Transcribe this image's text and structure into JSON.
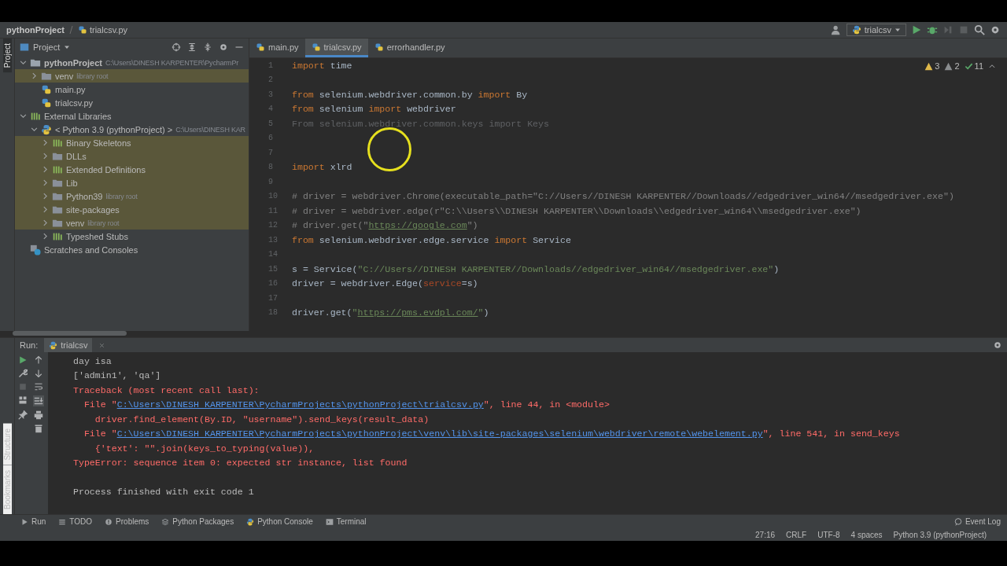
{
  "breadcrumb": {
    "project": "pythonProject",
    "file": "trialcsv.py"
  },
  "run_config": "trialcsv",
  "left_stripe_top": [
    {
      "label": "Project",
      "selected": true
    }
  ],
  "left_stripe_bottom": [
    {
      "label": "Structure",
      "selected": false
    },
    {
      "label": "Bookmarks",
      "selected": false
    }
  ],
  "project_panel": {
    "title": "Project",
    "tree": [
      {
        "name": "pythonProject",
        "hint": "C:\\Users\\DINESH KARPENTER\\PycharmPr",
        "kind": "project",
        "expanded": true,
        "highlighted": false,
        "children": [
          {
            "name": "venv",
            "hint": "library root",
            "kind": "folder",
            "expanded": false,
            "highlighted": true
          },
          {
            "name": "main.py",
            "kind": "pyfile",
            "highlighted": false
          },
          {
            "name": "trialcsv.py",
            "kind": "pyfile",
            "highlighted": false
          }
        ]
      },
      {
        "name": "External Libraries",
        "kind": "library",
        "expanded": true,
        "highlighted": false,
        "children": [
          {
            "name": "< Python 3.9 (pythonProject) >",
            "hint": "C:\\Users\\DINESH KAR",
            "kind": "python",
            "expanded": true,
            "highlighted": false,
            "children": [
              {
                "name": "Binary Skeletons",
                "kind": "library",
                "expanded": false,
                "highlighted": true
              },
              {
                "name": "DLLs",
                "kind": "folder",
                "expanded": false,
                "highlighted": true
              },
              {
                "name": "Extended Definitions",
                "kind": "library",
                "expanded": false,
                "highlighted": true
              },
              {
                "name": "Lib",
                "kind": "folder",
                "expanded": false,
                "highlighted": true
              },
              {
                "name": "Python39",
                "hint": "library root",
                "kind": "folder",
                "expanded": false,
                "highlighted": true
              },
              {
                "name": "site-packages",
                "kind": "folder",
                "expanded": false,
                "highlighted": true
              },
              {
                "name": "venv",
                "hint": "library root",
                "kind": "folder",
                "expanded": false,
                "highlighted": true
              },
              {
                "name": "Typeshed Stubs",
                "kind": "library",
                "expanded": false,
                "highlighted": false
              }
            ]
          }
        ]
      },
      {
        "name": "Scratches and Consoles",
        "kind": "scratches",
        "highlighted": false
      }
    ]
  },
  "editor_tabs": [
    {
      "label": "main.py",
      "selected": false
    },
    {
      "label": "trialcsv.py",
      "selected": true
    },
    {
      "label": "errorhandler.py",
      "selected": false
    }
  ],
  "inspections": {
    "warnings": "3",
    "weak_warnings": "2",
    "typos": "11"
  },
  "code": [
    {
      "number": "1",
      "tokens": [
        {
          "kind": "keyword",
          "text": "import"
        },
        {
          "kind": "plain",
          "text": " time"
        }
      ]
    },
    {
      "number": "2"
    },
    {
      "number": "3",
      "tokens": [
        {
          "kind": "keyword",
          "text": "from"
        },
        {
          "kind": "plain",
          "text": " selenium.webdriver.common.by "
        },
        {
          "kind": "keyword",
          "text": "import"
        },
        {
          "kind": "plain",
          "text": " By"
        }
      ]
    },
    {
      "number": "4",
      "tokens": [
        {
          "kind": "keyword",
          "text": "from"
        },
        {
          "kind": "plain",
          "text": " selenium "
        },
        {
          "kind": "keyword",
          "text": "import"
        },
        {
          "kind": "plain",
          "text": " webdriver"
        }
      ]
    },
    {
      "number": "5",
      "tokens": [
        {
          "kind": "unused",
          "text": "From selenium.webdriver.common.keys import Keys"
        }
      ]
    },
    {
      "number": "6"
    },
    {
      "number": "7"
    },
    {
      "number": "8",
      "tokens": [
        {
          "kind": "keyword",
          "text": "import"
        },
        {
          "kind": "plain",
          "text": " xlrd"
        }
      ]
    },
    {
      "number": "9"
    },
    {
      "number": "10",
      "tokens": [
        {
          "kind": "comment",
          "text": "# driver = webdriver.Chrome(executable_path=\"C://Users//DINESH KARPENTER//Downloads//edgedriver_win64//msedgedriver.exe\")"
        }
      ]
    },
    {
      "number": "11",
      "tokens": [
        {
          "kind": "comment",
          "text": "# driver = webdriver.edge(r\"C:\\\\Users\\\\DINESH KARPENTER\\\\Downloads\\\\edgedriver_win64\\\\msedgedriver.exe\")"
        }
      ]
    },
    {
      "number": "12",
      "tokens": [
        {
          "kind": "comment",
          "text": "# driver.get(\""
        },
        {
          "kind": "url",
          "text": "https://google.com"
        },
        {
          "kind": "comment",
          "text": "\")"
        }
      ]
    },
    {
      "number": "13",
      "tokens": [
        {
          "kind": "keyword",
          "text": "from"
        },
        {
          "kind": "plain",
          "text": " selenium.webdriver.edge.service "
        },
        {
          "kind": "keyword",
          "text": "import"
        },
        {
          "kind": "plain",
          "text": " Service"
        }
      ]
    },
    {
      "number": "14"
    },
    {
      "number": "15",
      "tokens": [
        {
          "kind": "plain",
          "text": "s = Service("
        },
        {
          "kind": "string",
          "text": "\"C://Users//DINESH KARPENTER//Downloads//edgedriver_win64//msedgedriver.exe\""
        },
        {
          "kind": "plain",
          "text": ")"
        }
      ]
    },
    {
      "number": "16",
      "tokens": [
        {
          "kind": "plain",
          "text": "driver = webdriver.Edge("
        },
        {
          "kind": "param",
          "text": "service"
        },
        {
          "kind": "plain",
          "text": "=s)"
        }
      ]
    },
    {
      "number": "17"
    },
    {
      "number": "18",
      "tokens": [
        {
          "kind": "plain",
          "text": "driver.get("
        },
        {
          "kind": "string",
          "text": "\""
        },
        {
          "kind": "url",
          "text": "https://pms.evdpl.com/"
        },
        {
          "kind": "string",
          "text": "\""
        },
        {
          "kind": "plain",
          "text": ")"
        }
      ]
    }
  ],
  "run_panel": {
    "label": "Run:",
    "tab": "trialcsv",
    "output": [
      {
        "tokens": [
          {
            "kind": "plain",
            "text": "day isa"
          }
        ]
      },
      {
        "tokens": [
          {
            "kind": "plain",
            "text": "['admin1', 'qa']"
          }
        ]
      },
      {
        "tokens": [
          {
            "kind": "error",
            "text": "Traceback (most recent call last):"
          }
        ]
      },
      {
        "tokens": [
          {
            "kind": "error",
            "text": "  File \""
          },
          {
            "kind": "link",
            "text": "C:\\Users\\DINESH KARPENTER\\PycharmProjects\\pythonProject\\trialcsv.py"
          },
          {
            "kind": "error",
            "text": "\", line 44, in <module>"
          }
        ]
      },
      {
        "tokens": [
          {
            "kind": "error",
            "text": "    driver.find_element(By.ID, \"username\").send_keys(result_data)"
          }
        ]
      },
      {
        "tokens": [
          {
            "kind": "error",
            "text": "  File \""
          },
          {
            "kind": "link",
            "text": "C:\\Users\\DINESH KARPENTER\\PycharmProjects\\pythonProject\\venv\\lib\\site-packages\\selenium\\webdriver\\remote\\webelement.py"
          },
          {
            "kind": "error",
            "text": "\", line 541, in send_keys"
          }
        ]
      },
      {
        "tokens": [
          {
            "kind": "error",
            "text": "    {'text': \"\".join(keys_to_typing(value)),"
          }
        ]
      },
      {
        "tokens": [
          {
            "kind": "error",
            "text": "TypeError: sequence item 0: expected str instance, list found"
          }
        ]
      }
    ],
    "exit_message": "Process finished with exit code 1"
  },
  "tool_tabs": [
    {
      "label": "Run",
      "kind": "run"
    },
    {
      "label": "TODO",
      "kind": "todo"
    },
    {
      "label": "Problems",
      "kind": "problems"
    },
    {
      "label": "Python Packages",
      "kind": "packages"
    },
    {
      "label": "Python Console",
      "kind": "console"
    },
    {
      "label": "Terminal",
      "kind": "terminal"
    }
  ],
  "event_log": "Event Log",
  "status_bar": [
    "27:16",
    "CRLF",
    "UTF-8",
    "4 spaces",
    "Python 3.9 (pythonProject)"
  ]
}
